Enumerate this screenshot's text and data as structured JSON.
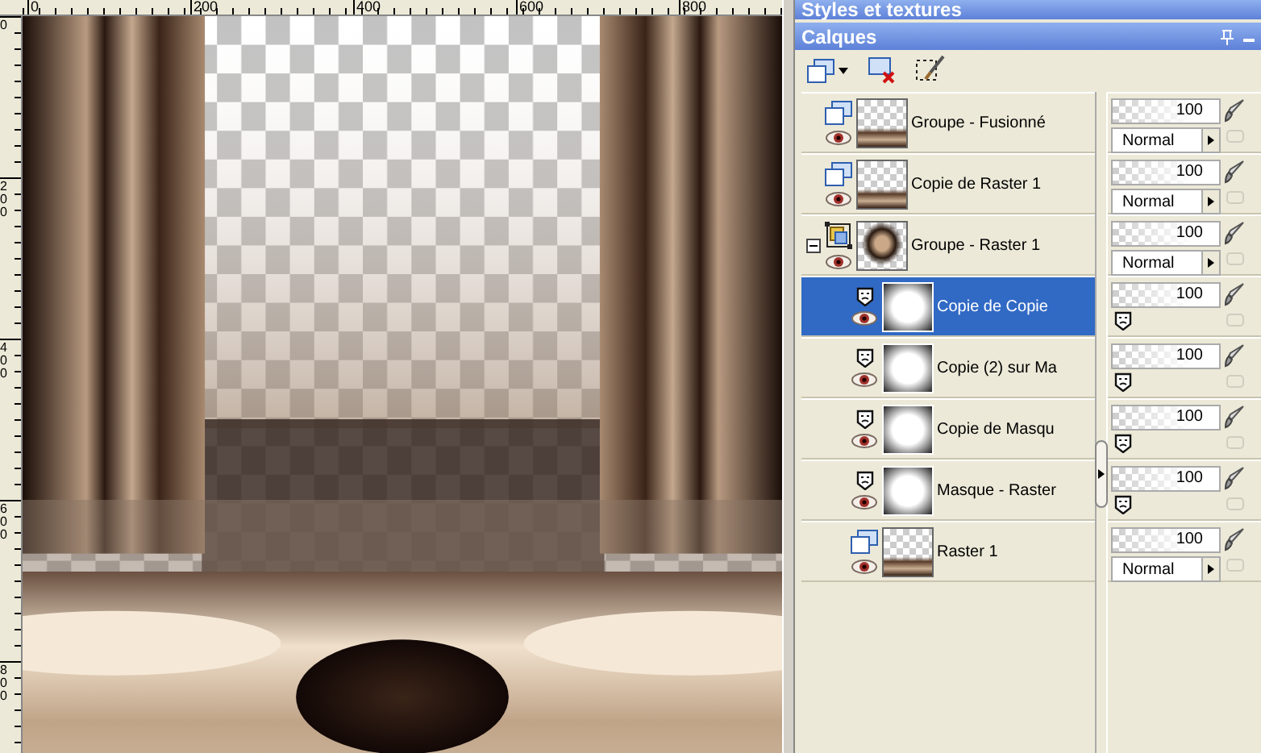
{
  "rulers": {
    "horizontal": [
      "0",
      "200",
      "400",
      "600",
      "800"
    ],
    "vertical": [
      "0",
      "200",
      "400",
      "600",
      "800"
    ]
  },
  "palettes": {
    "styles_title": "Styles et textures",
    "layers_title": "Calques"
  },
  "layers": [
    {
      "name": "Groupe - Fusionné",
      "kind": "raster",
      "opacity": "100",
      "blend": "Normal",
      "selected": false,
      "visible": true
    },
    {
      "name": "Copie de Raster 1",
      "kind": "raster",
      "opacity": "100",
      "blend": "Normal",
      "selected": false,
      "visible": true
    },
    {
      "name": "Groupe - Raster 1",
      "kind": "group",
      "opacity": "100",
      "blend": "Normal",
      "selected": false,
      "visible": true,
      "expanded": true,
      "children": [
        {
          "name": "Copie de Copie",
          "kind": "mask",
          "opacity": "100",
          "selected": true,
          "visible": true
        },
        {
          "name": "Copie (2) sur Ma",
          "kind": "mask",
          "opacity": "100",
          "selected": false,
          "visible": true
        },
        {
          "name": "Copie de Masqu",
          "kind": "mask",
          "opacity": "100",
          "selected": false,
          "visible": true
        },
        {
          "name": "Masque - Raster",
          "kind": "mask",
          "opacity": "100",
          "selected": false,
          "visible": true
        },
        {
          "name": "Raster 1",
          "kind": "raster",
          "opacity": "100",
          "blend": "Normal",
          "selected": false,
          "visible": true
        }
      ]
    }
  ]
}
